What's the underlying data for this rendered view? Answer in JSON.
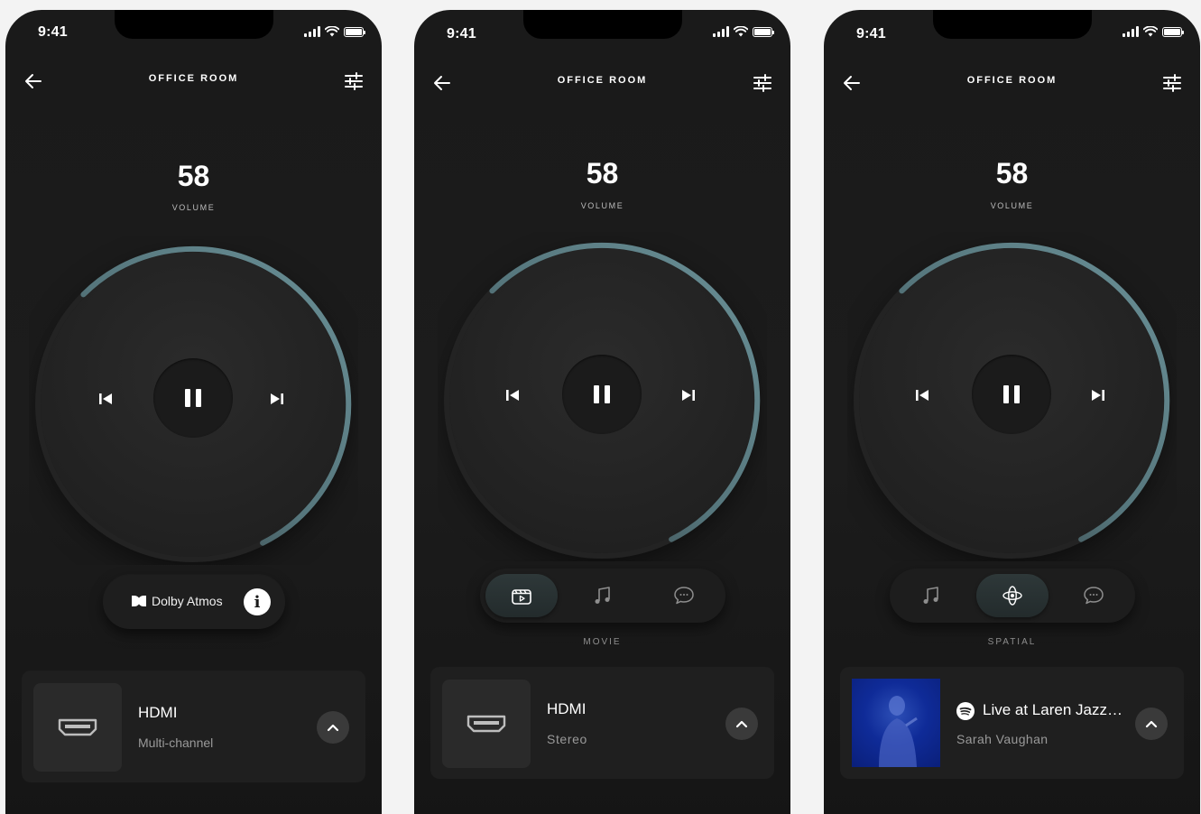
{
  "status": {
    "time": "9:41"
  },
  "colors": {
    "accent": "#5b7f86",
    "background": "#1a1a1a",
    "card": "#1f1f1f",
    "album": "#0f2b98",
    "spotify": "#ffffff"
  },
  "icons": {
    "back": "arrow-left-icon",
    "settings": "sliders-icon",
    "prev": "skip-previous-icon",
    "pause": "pause-icon",
    "next": "skip-next-icon",
    "movie": "clapperboard-icon",
    "music": "music-note-icon",
    "voice": "speech-bubble-icon",
    "spatial": "spatial-audio-icon",
    "hdmi": "hdmi-icon",
    "expand": "chevron-up-icon",
    "info": "info-icon",
    "dolby": "dolby-icon",
    "spotify": "spotify-icon"
  },
  "phones": [
    {
      "room": "OFFICE ROOM",
      "volume": "58",
      "volume_label": "VOLUME",
      "volume_level": 0.58,
      "dolby": {
        "label": "Dolby Atmos",
        "info": "i"
      },
      "source": {
        "title": "HDMI",
        "subtitle": "Multi-channel"
      }
    },
    {
      "room": "OFFICE ROOM",
      "volume": "58",
      "volume_label": "VOLUME",
      "volume_level": 0.58,
      "modes": [
        "movie",
        "music",
        "voice"
      ],
      "active_mode": "movie",
      "mode_label": "MOVIE",
      "source": {
        "title": "HDMI",
        "subtitle": "Stereo"
      }
    },
    {
      "room": "OFFICE ROOM",
      "volume": "58",
      "volume_label": "VOLUME",
      "volume_level": 0.58,
      "modes": [
        "music",
        "spatial",
        "voice"
      ],
      "active_mode": "spatial",
      "mode_label": "SPATIAL",
      "now_playing": {
        "title": "Live at Laren Jazz…",
        "artist": "Sarah Vaughan"
      }
    }
  ]
}
